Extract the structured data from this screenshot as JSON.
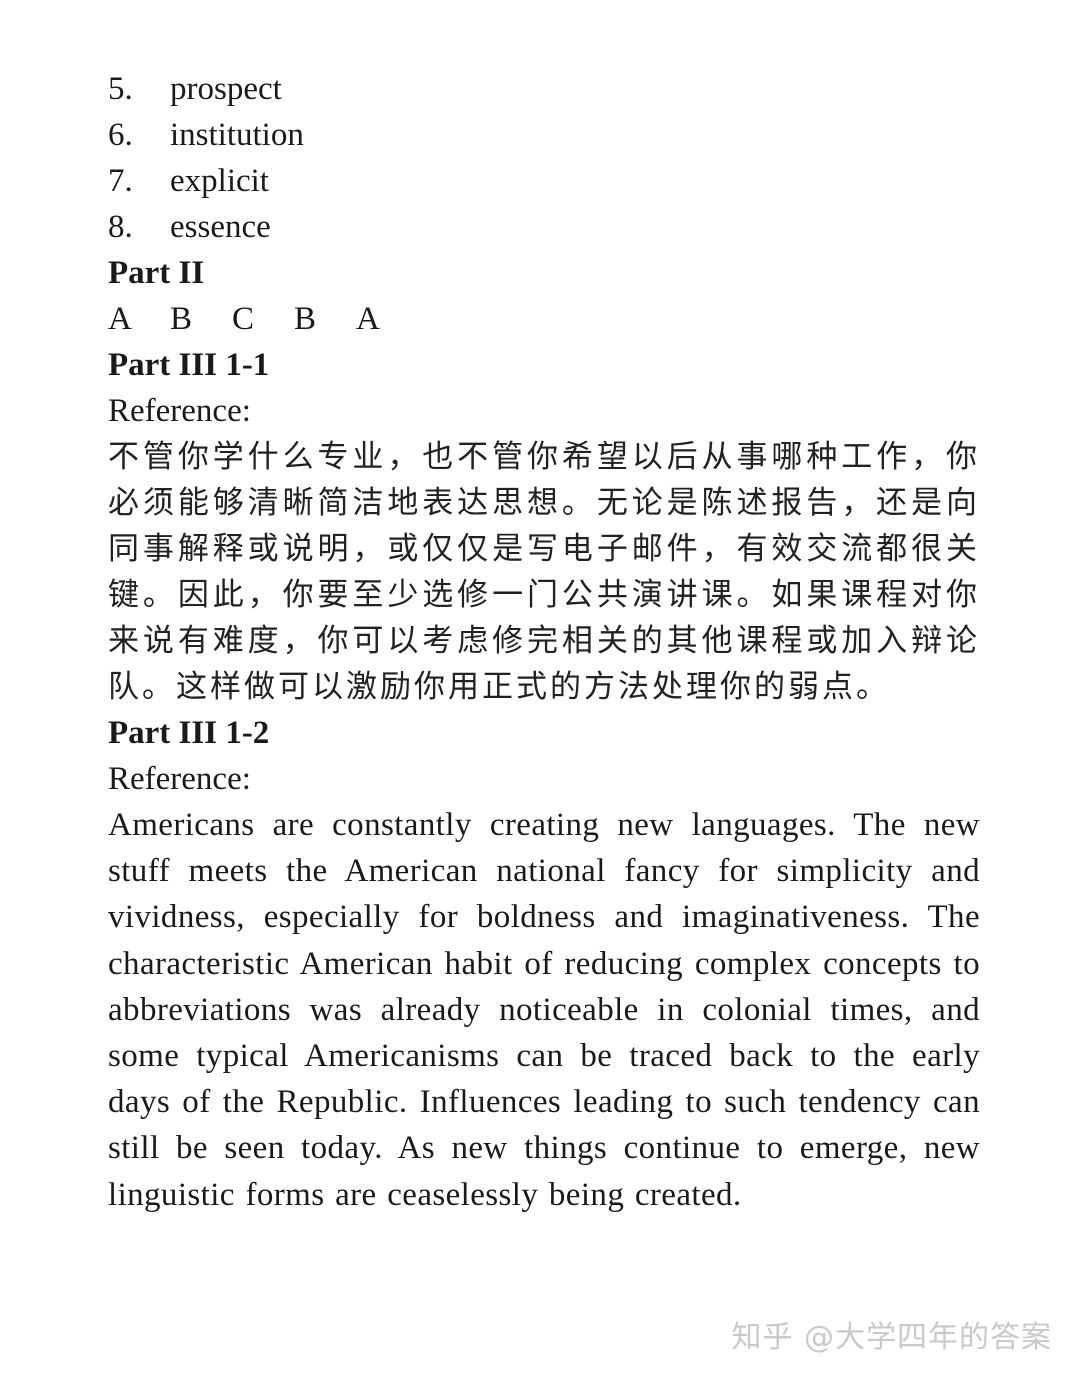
{
  "vocab": [
    {
      "num": "5.",
      "word": "prospect"
    },
    {
      "num": "6.",
      "word": "institution"
    },
    {
      "num": "7.",
      "word": "explicit"
    },
    {
      "num": "8.",
      "word": "essence"
    }
  ],
  "part2": {
    "heading": "Part II",
    "answers": [
      "A",
      "B",
      "C",
      "B",
      "A"
    ]
  },
  "part3_1": {
    "heading": "Part III 1-1",
    "label": "Reference:",
    "text": "不管你学什么专业，也不管你希望以后从事哪种工作，你必须能够清晰简洁地表达思想。无论是陈述报告，还是向同事解释或说明，或仅仅是写电子邮件，有效交流都很关键。因此，你要至少选修一门公共演讲课。如果课程对你来说有难度，你可以考虑修完相关的其他课程或加入辩论队。这样做可以激励你用正式的方法处理你的弱点。"
  },
  "part3_2": {
    "heading": "Part III 1-2",
    "label": "Reference:",
    "text": "Americans are constantly creating new languages. The new stuff meets the American national fancy for simplicity and vividness, especially for boldness and imaginativeness. The characteristic American habit of reducing complex concepts to abbreviations was already noticeable in colonial times, and some typical Americanisms can be traced back to the early days of the Republic. Influences leading to such tendency can still be seen today. As new things continue to emerge, new linguistic forms are ceaselessly being created."
  },
  "watermark": "知乎 @大学四年的答案"
}
